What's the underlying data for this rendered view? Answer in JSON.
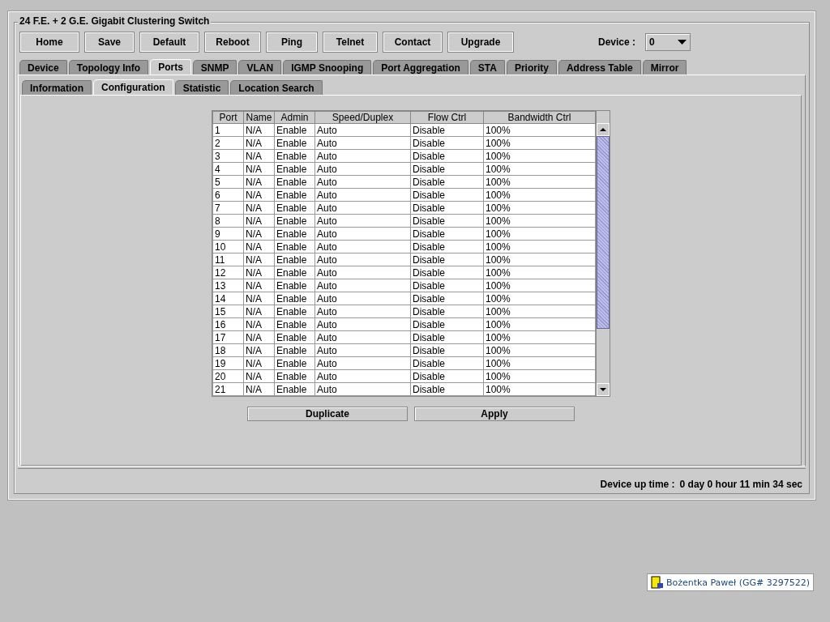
{
  "window": {
    "title": "24 F.E. + 2 G.E. Gigabit Clustering Switch"
  },
  "toolbar": {
    "buttons": [
      "Home",
      "Save",
      "Default",
      "Reboot",
      "Ping",
      "Telnet",
      "Contact",
      "Upgrade"
    ],
    "device_label": "Device :",
    "device_value": "0"
  },
  "tabs": [
    {
      "label": "Device",
      "selected": false
    },
    {
      "label": "Topology Info",
      "selected": false
    },
    {
      "label": "Ports",
      "selected": true
    },
    {
      "label": "SNMP",
      "selected": false
    },
    {
      "label": "VLAN",
      "selected": false
    },
    {
      "label": "IGMP Snooping",
      "selected": false
    },
    {
      "label": "Port Aggregation",
      "selected": false
    },
    {
      "label": "STA",
      "selected": false
    },
    {
      "label": "Priority",
      "selected": false
    },
    {
      "label": "Address Table",
      "selected": false
    },
    {
      "label": "Mirror",
      "selected": false
    }
  ],
  "subtabs": [
    {
      "label": "Information",
      "selected": false
    },
    {
      "label": "Configuration",
      "selected": true
    },
    {
      "label": "Statistic",
      "selected": false
    },
    {
      "label": "Location Search",
      "selected": false
    }
  ],
  "table": {
    "columns": [
      "Port",
      "Name",
      "Admin",
      "Speed/Duplex",
      "Flow Ctrl",
      "Bandwidth Ctrl"
    ],
    "rows": [
      [
        "1",
        "N/A",
        "Enable",
        "Auto",
        "Disable",
        "100%"
      ],
      [
        "2",
        "N/A",
        "Enable",
        "Auto",
        "Disable",
        "100%"
      ],
      [
        "3",
        "N/A",
        "Enable",
        "Auto",
        "Disable",
        "100%"
      ],
      [
        "4",
        "N/A",
        "Enable",
        "Auto",
        "Disable",
        "100%"
      ],
      [
        "5",
        "N/A",
        "Enable",
        "Auto",
        "Disable",
        "100%"
      ],
      [
        "6",
        "N/A",
        "Enable",
        "Auto",
        "Disable",
        "100%"
      ],
      [
        "7",
        "N/A",
        "Enable",
        "Auto",
        "Disable",
        "100%"
      ],
      [
        "8",
        "N/A",
        "Enable",
        "Auto",
        "Disable",
        "100%"
      ],
      [
        "9",
        "N/A",
        "Enable",
        "Auto",
        "Disable",
        "100%"
      ],
      [
        "10",
        "N/A",
        "Enable",
        "Auto",
        "Disable",
        "100%"
      ],
      [
        "11",
        "N/A",
        "Enable",
        "Auto",
        "Disable",
        "100%"
      ],
      [
        "12",
        "N/A",
        "Enable",
        "Auto",
        "Disable",
        "100%"
      ],
      [
        "13",
        "N/A",
        "Enable",
        "Auto",
        "Disable",
        "100%"
      ],
      [
        "14",
        "N/A",
        "Enable",
        "Auto",
        "Disable",
        "100%"
      ],
      [
        "15",
        "N/A",
        "Enable",
        "Auto",
        "Disable",
        "100%"
      ],
      [
        "16",
        "N/A",
        "Enable",
        "Auto",
        "Disable",
        "100%"
      ],
      [
        "17",
        "N/A",
        "Enable",
        "Auto",
        "Disable",
        "100%"
      ],
      [
        "18",
        "N/A",
        "Enable",
        "Auto",
        "Disable",
        "100%"
      ],
      [
        "19",
        "N/A",
        "Enable",
        "Auto",
        "Disable",
        "100%"
      ],
      [
        "20",
        "N/A",
        "Enable",
        "Auto",
        "Disable",
        "100%"
      ],
      [
        "21",
        "N/A",
        "Enable",
        "Auto",
        "Disable",
        "100%"
      ]
    ]
  },
  "actions": [
    "Duplicate",
    "Apply"
  ],
  "status_bar": {
    "label": "Device up time :",
    "value": "0 day 0 hour 11 min 34 sec"
  },
  "badge": {
    "text": "Bożentka Paweł (GG# 3297522)"
  }
}
